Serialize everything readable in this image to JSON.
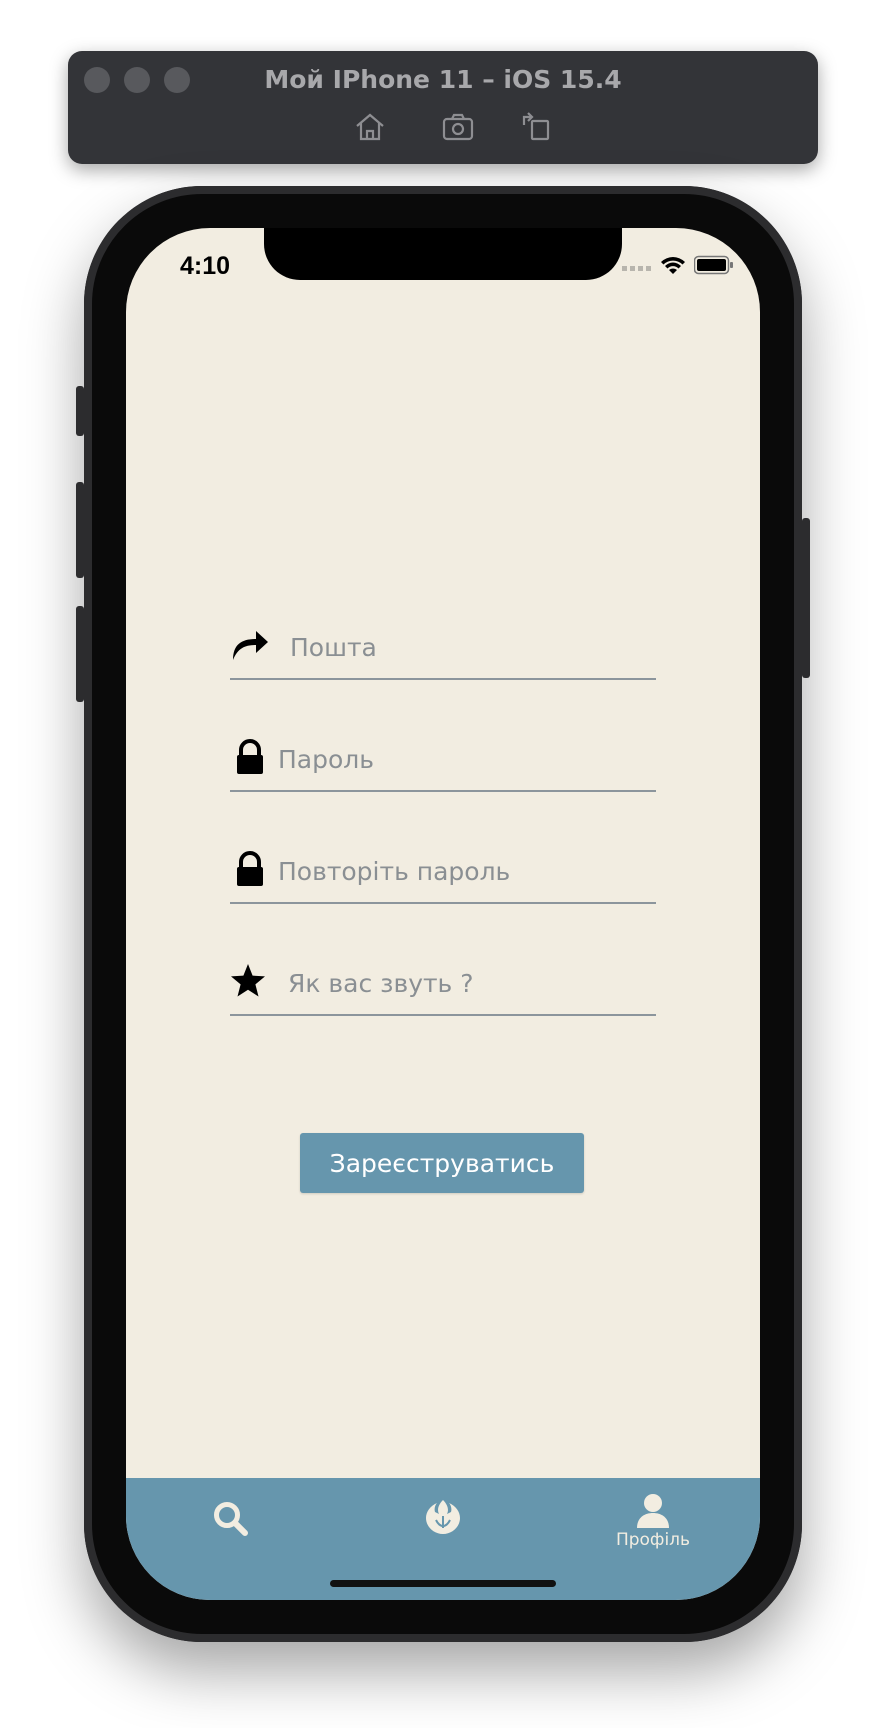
{
  "simulator": {
    "title": "Мой IPhone 11 – iOS 15.4",
    "tools": [
      "home-icon",
      "screenshot-icon",
      "rotate-icon"
    ]
  },
  "status_bar": {
    "time": "4:10",
    "icons": [
      "cellular-icon",
      "wifi-icon",
      "battery-icon"
    ]
  },
  "form": {
    "fields": [
      {
        "icon": "share-arrow-icon",
        "placeholder": "Пошта",
        "value": ""
      },
      {
        "icon": "lock-icon",
        "placeholder": "Пароль",
        "value": ""
      },
      {
        "icon": "lock-icon",
        "placeholder": "Повторіть пароль",
        "value": ""
      },
      {
        "icon": "star-icon",
        "placeholder": "Як вас звуть ?",
        "value": ""
      }
    ],
    "submit_label": "Зареєструватись"
  },
  "tab_bar": {
    "tabs": [
      {
        "icon": "search-icon",
        "label": ""
      },
      {
        "icon": "rebel-alliance-icon",
        "label": ""
      },
      {
        "icon": "user-icon",
        "label": "Профіль",
        "active": true
      }
    ]
  },
  "colors": {
    "background": "#f2ede1",
    "accent": "#6696ad",
    "field_underline": "#8c959c",
    "placeholder": "#8a8f93"
  }
}
